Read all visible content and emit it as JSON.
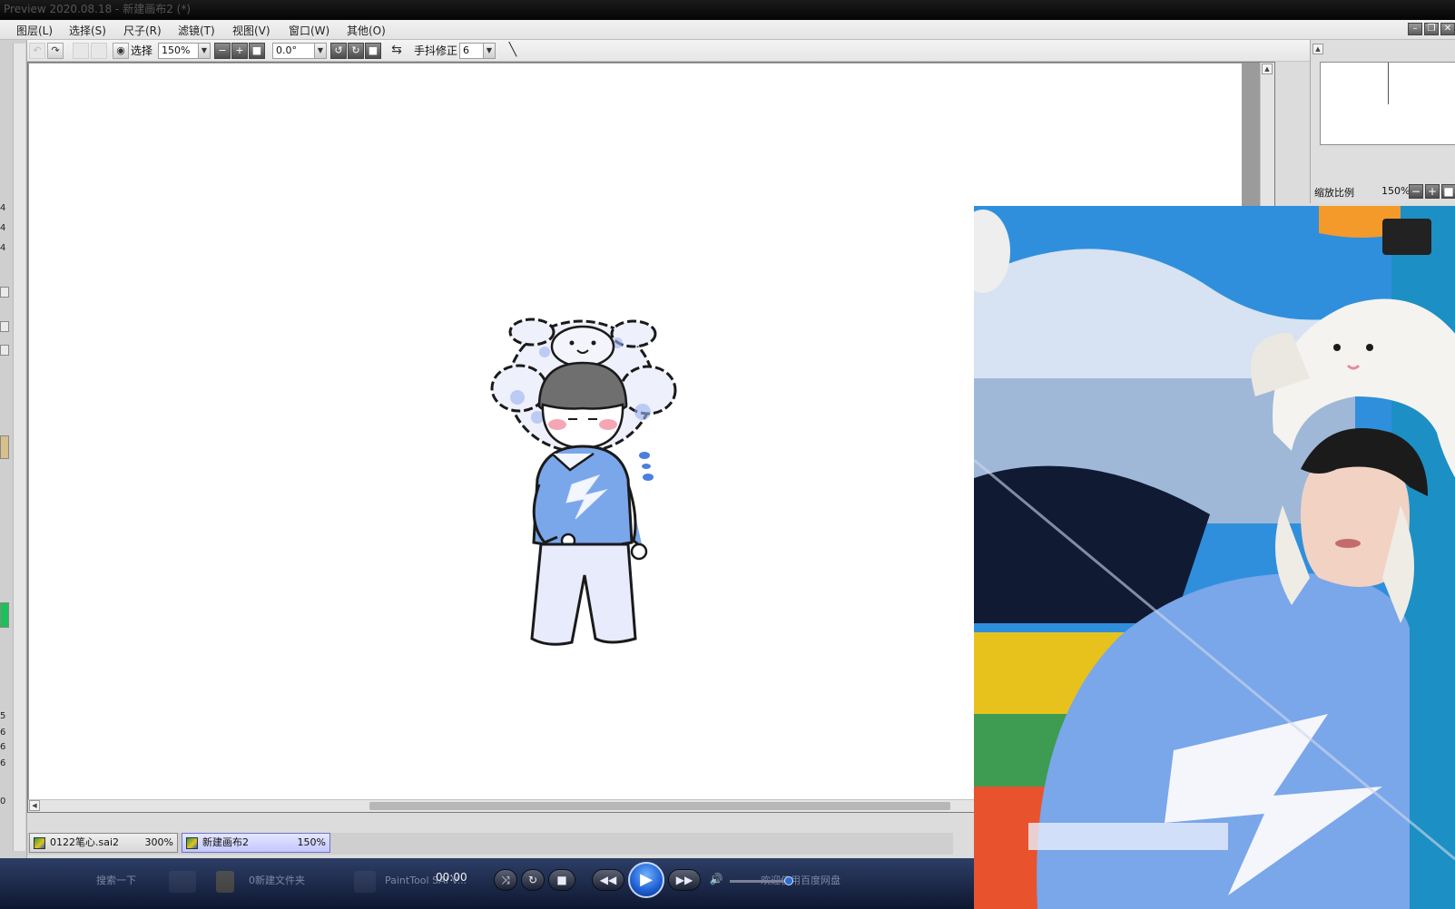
{
  "window": {
    "title": "Preview 2020.08.18 - 新建画布2 (*)"
  },
  "menu": {
    "items": [
      "图层(L)",
      "选择(S)",
      "尺子(R)",
      "滤镜(T)",
      "视图(V)",
      "窗口(W)",
      "其他(O)"
    ]
  },
  "toolbar": {
    "select_label": "选择",
    "zoom_value": "150%",
    "rotate_value": "0.0°",
    "stabilizer_label": "手抖修正",
    "stabilizer_value": "6"
  },
  "left_strip": {
    "numbers": [
      "4",
      "4",
      "4",
      "5",
      "6",
      "6",
      "6",
      "0"
    ]
  },
  "navigator": {
    "zoom_label": "缩放比例",
    "zoom_value": "150%"
  },
  "file_tabs": [
    {
      "name": "0122笔心.sai2",
      "zoom": "300%",
      "active": false
    },
    {
      "name": "新建画布2",
      "zoom": "150%",
      "active": true
    }
  ],
  "taskbar": {
    "search_label": "搜索一下",
    "folder_label": "0新建文件夹",
    "paint_label": "PaintTool SAI V...",
    "cloud_label": "欢迎使用百度网盘"
  },
  "media": {
    "time": "00:00"
  },
  "colors": {
    "canvas_bg": "#ffffff",
    "accent_blue": "#4a7fe0",
    "swatch_tan": "#d7c08a",
    "swatch_green": "#19c25a",
    "sweater_blue": "#7aa6ea"
  }
}
